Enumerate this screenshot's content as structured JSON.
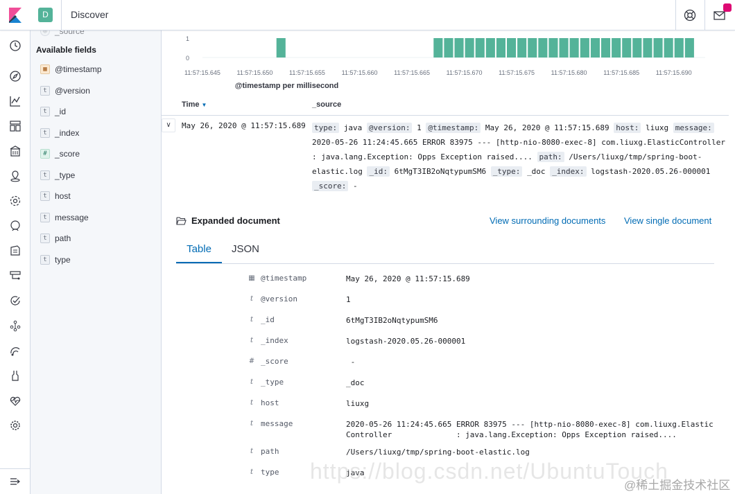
{
  "header": {
    "space_initial": "D",
    "app_title": "Discover",
    "news_badge": "•",
    "brand_color": "#e8488b",
    "space_color": "#54b399"
  },
  "nav": {
    "icons": [
      "clock-icon",
      "compass-icon",
      "visualize-icon",
      "dashboard-icon",
      "canvas-icon",
      "maps-icon",
      "ml-icon",
      "siem-icon",
      "logs-icon",
      "infrastructure-icon",
      "uptime-icon",
      "graph-icon",
      "apm-icon",
      "dev-tools-icon",
      "monitoring-icon",
      "settings-icon",
      "collapse-icon"
    ]
  },
  "fields": {
    "partial_label": "_source",
    "title": "Available fields",
    "items": [
      {
        "type": "date",
        "glyph": "▦",
        "name": "@timestamp"
      },
      {
        "type": "string",
        "glyph": "t",
        "name": "@version"
      },
      {
        "type": "string",
        "glyph": "t",
        "name": "_id"
      },
      {
        "type": "string",
        "glyph": "t",
        "name": "_index"
      },
      {
        "type": "number",
        "glyph": "#",
        "name": "_score"
      },
      {
        "type": "string",
        "glyph": "t",
        "name": "_type"
      },
      {
        "type": "string",
        "glyph": "t",
        "name": "host"
      },
      {
        "type": "string",
        "glyph": "t",
        "name": "message"
      },
      {
        "type": "string",
        "glyph": "t",
        "name": "path"
      },
      {
        "type": "string",
        "glyph": "t",
        "name": "type"
      }
    ]
  },
  "chart_data": {
    "type": "bar",
    "xlabel": "@timestamp per millisecond",
    "ylabel": "",
    "ylim": [
      0,
      1
    ],
    "y_ticks": [
      "1",
      "0"
    ],
    "x_tick_labels": [
      "11:57:15.645",
      "11:57:15.650",
      "11:57:15.655",
      "11:57:15.660",
      "11:57:15.665",
      "11:57:15.670",
      "11:57:15.675",
      "11:57:15.680",
      "11:57:15.685",
      "11:57:15.690"
    ],
    "x": [
      645,
      646,
      647,
      648,
      649,
      650,
      651,
      652,
      653,
      654,
      655,
      656,
      657,
      658,
      659,
      660,
      661,
      662,
      663,
      664,
      665,
      666,
      667,
      668,
      669,
      670,
      671,
      672,
      673,
      674,
      675,
      676,
      677,
      678,
      679,
      680,
      681,
      682,
      683,
      684,
      685,
      686,
      687,
      688,
      689,
      690,
      691,
      692
    ],
    "values": [
      0,
      0,
      0,
      0,
      0,
      0,
      0,
      1,
      0,
      0,
      0,
      0,
      0,
      0,
      0,
      0,
      0,
      0,
      0,
      0,
      0,
      0,
      1,
      1,
      1,
      1,
      1,
      1,
      1,
      1,
      1,
      1,
      1,
      1,
      1,
      1,
      1,
      1,
      1,
      1,
      1,
      1,
      1,
      1,
      1,
      1,
      1,
      0
    ],
    "bar_color": "#54b399",
    "grid": false
  },
  "table": {
    "time_header": "Time",
    "source_header": "_source",
    "row": {
      "toggle": "∨",
      "time": "May 26, 2020 @ 11:57:15.689",
      "source": [
        {
          "k": "type:",
          "v": "java"
        },
        {
          "k": "@version:",
          "v": "1"
        },
        {
          "k": "@timestamp:",
          "v": "May 26, 2020 @ 11:57:15.689"
        },
        {
          "k": "host:",
          "v": "liuxg"
        },
        {
          "k": "message:",
          "v": "2020-05-26 11:24:45.665 ERROR 83975 --- [http-nio-8080-exec-8] com.liuxg.ElasticController : java.lang.Exception: Opps Exception raised...."
        },
        {
          "k": "path:",
          "v": "/Users/liuxg/tmp/spring-boot-elastic.log"
        },
        {
          "k": "_id:",
          "v": "6tMgT3IB2oNqtypumSM6"
        },
        {
          "k": "_type:",
          "v": "_doc"
        },
        {
          "k": "_index:",
          "v": "logstash-2020.05.26-000001"
        },
        {
          "k": "_score:",
          "v": "-"
        }
      ]
    }
  },
  "expanded": {
    "title": "Expanded document",
    "link_surrounding": "View surrounding documents",
    "link_single": "View single document",
    "tab_table": "Table",
    "tab_json": "JSON",
    "rows": [
      {
        "icon": "▦",
        "field": "@timestamp",
        "value": "May 26, 2020 @ 11:57:15.689"
      },
      {
        "icon": "t",
        "field": "@version",
        "value": "1"
      },
      {
        "icon": "t",
        "field": "_id",
        "value": "6tMgT3IB2oNqtypumSM6"
      },
      {
        "icon": "t",
        "field": "_index",
        "value": "logstash-2020.05.26-000001"
      },
      {
        "icon": "#",
        "field": "_score",
        "value": " -"
      },
      {
        "icon": "t",
        "field": "_type",
        "value": "_doc"
      },
      {
        "icon": "t",
        "field": "host",
        "value": "liuxg"
      },
      {
        "icon": "t",
        "field": "message",
        "value": "2020-05-26 11:24:45.665 ERROR 83975 --- [http-nio-8080-exec-8] com.liuxg.ElasticController              : java.lang.Exception: Opps Exception raised...."
      },
      {
        "icon": "t",
        "field": "path",
        "value": "/Users/liuxg/tmp/spring-boot-elastic.log"
      },
      {
        "icon": "t",
        "field": "type",
        "value": "java"
      }
    ]
  },
  "watermark": {
    "url": "https://blog.csdn.net/UbuntuTouch",
    "site": "@稀土掘金技术社区"
  }
}
